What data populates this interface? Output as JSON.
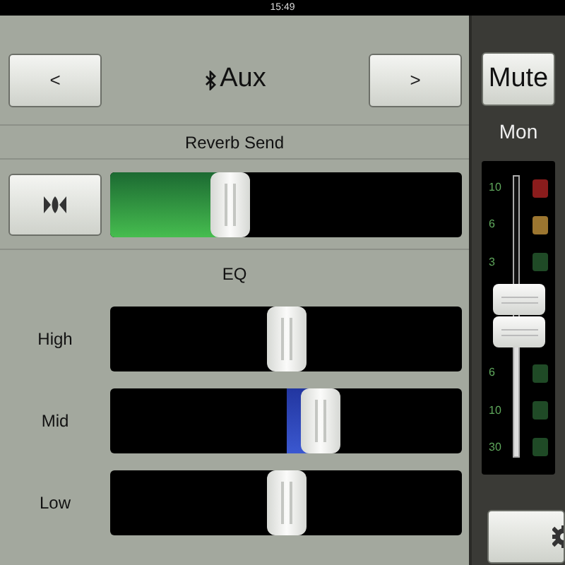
{
  "status_bar": {
    "time": "15:49"
  },
  "header": {
    "prev_button": "<",
    "title": "Aux",
    "next_button": ">"
  },
  "reverb": {
    "heading": "Reverb Send",
    "slider": {
      "kind": "from-left",
      "level": 0.32
    }
  },
  "eq": {
    "heading": "EQ",
    "bands": [
      {
        "label": "High",
        "kind": "from-center",
        "level": 0.5
      },
      {
        "label": "Mid",
        "kind": "from-center",
        "level": 0.61
      },
      {
        "label": "Low",
        "kind": "from-center",
        "level": 0.5
      }
    ]
  },
  "monitor": {
    "mute_button": "Mute",
    "label": "Mon",
    "fader": {
      "level": 0.5
    },
    "meter_upper": [
      {
        "label": "10",
        "color": "#8a1c1c"
      },
      {
        "label": "6",
        "color": "#9c7630"
      },
      {
        "label": "3",
        "color": "#1f4a26"
      }
    ],
    "meter_lower": [
      {
        "label": "6",
        "color": "#1f4a26"
      },
      {
        "label": "10",
        "color": "#1f4a26"
      },
      {
        "label": "30",
        "color": "#1f4a26"
      }
    ]
  }
}
